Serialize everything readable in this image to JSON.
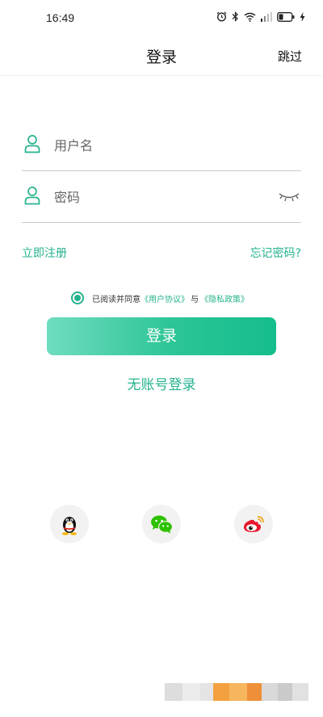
{
  "status_bar": {
    "time": "16:49",
    "icons": [
      "alarm-icon",
      "bluetooth-icon",
      "wifi-icon",
      "signal-icon",
      "battery-icon",
      "charging-icon"
    ]
  },
  "nav": {
    "title": "登录",
    "skip": "跳过"
  },
  "form": {
    "username_placeholder": "用户名",
    "password_placeholder": "密码"
  },
  "links": {
    "register": "立即注册",
    "forgot": "忘记密码?"
  },
  "agreement": {
    "prefix": "已阅读并同意",
    "user_agreement": "《用户协议》",
    "conjunction": "与",
    "privacy_policy": "《隐私政策》",
    "checked": true
  },
  "login_button": "登录",
  "no_account_login": "无账号登录",
  "social": [
    "qq-icon",
    "wechat-icon",
    "weibo-icon"
  ],
  "colors": {
    "accent": "#26b28f",
    "button_start": "#6fdcc0",
    "button_end": "#15bd8d"
  }
}
